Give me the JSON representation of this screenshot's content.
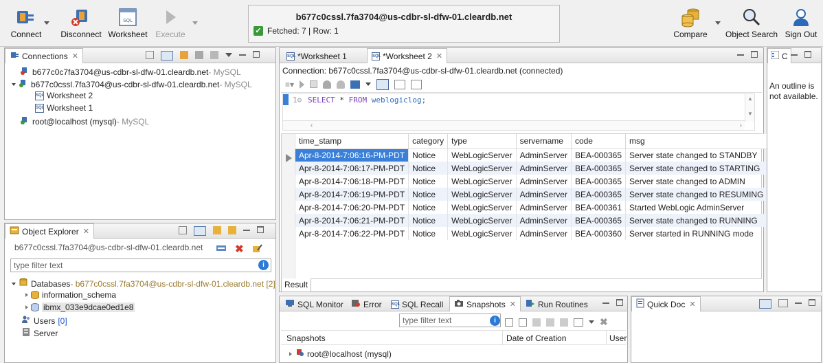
{
  "toolbar": {
    "connect": "Connect",
    "disconnect": "Disconnect",
    "worksheet": "Worksheet",
    "execute": "Execute",
    "compare": "Compare",
    "object_search": "Object Search",
    "sign_out": "Sign Out"
  },
  "status": {
    "title": "b677c0cssl.7fa3704@us-cdbr-sl-dfw-01.cleardb.net",
    "fetched": "Fetched: 7 | Row: 1"
  },
  "connections": {
    "tab": "Connections",
    "items": [
      {
        "name": "b677c0c7fa3704@us-cdbr-sl-dfw-01.cleardb.net",
        "type": " - MySQL"
      },
      {
        "name": "b677c0cssl.7fa3704@us-cdbr-sl-dfw-01.cleardb.net",
        "type": " - MySQL"
      },
      {
        "name": "Worksheet 2"
      },
      {
        "name": "Worksheet 1"
      },
      {
        "name": "root@localhost (mysql)",
        "type": " - MySQL"
      }
    ]
  },
  "object_explorer": {
    "tab": "Object Explorer",
    "connection": "b677c0cssl.7fa3704@us-cdbr-sl-dfw-01.cleardb.net",
    "filter_placeholder": "type filter text",
    "databases_label": "Databases",
    "databases_suffix": " - b677c0cssl.7fa3704@us-cdbr-sl-dfw-01.cleardb.net [2]",
    "schemas": [
      "information_schema",
      "ibmx_033e9dcae0ed1e8"
    ],
    "users_label": "Users",
    "users_count": "[0]",
    "server_label": "Server"
  },
  "editor": {
    "tabs": [
      "*Worksheet 1",
      "*Worksheet 2"
    ],
    "connection": "Connection: b677c0cssl.7fa3704@us-cdbr-sl-dfw-01.cleardb.net (connected)",
    "line_no": "1",
    "sql_kw1": "SELECT",
    "sql_star": " * ",
    "sql_kw2": "FROM",
    "sql_table": " weblogiclog;"
  },
  "result": {
    "columns": [
      "time_stamp",
      "category",
      "type",
      "servername",
      "code",
      "msg"
    ],
    "rows": [
      [
        "Apr-8-2014-7:06:16-PM-PDT",
        "Notice",
        "WebLogicServer",
        "AdminServer",
        "BEA-000365",
        "Server state changed to STANDBY"
      ],
      [
        "Apr-8-2014-7:06:17-PM-PDT",
        "Notice",
        "WebLogicServer",
        "AdminServer",
        "BEA-000365",
        "Server state changed to STARTING"
      ],
      [
        "Apr-8-2014-7:06:18-PM-PDT",
        "Notice",
        "WebLogicServer",
        "AdminServer",
        "BEA-000365",
        "Server state changed to ADMIN"
      ],
      [
        "Apr-8-2014-7:06:19-PM-PDT",
        "Notice",
        "WebLogicServer",
        "AdminServer",
        "BEA-000365",
        "Server state changed to RESUMING"
      ],
      [
        "Apr-8-2014-7:06:20-PM-PDT",
        "Notice",
        "WebLogicServer",
        "AdminServer",
        "BEA-000361",
        "Started WebLogic AdminServer"
      ],
      [
        "Apr-8-2014-7:06:21-PM-PDT",
        "Notice",
        "WebLogicServer",
        "AdminServer",
        "BEA-000365",
        "Server state changed to RUNNING"
      ],
      [
        "Apr-8-2014-7:06:22-PM-PDT",
        "Notice",
        "WebLogicServer",
        "AdminServer",
        "BEA-000360",
        "Server started in RUNNING mode"
      ]
    ],
    "tab": "Result"
  },
  "outline": {
    "tab": "C",
    "message": "An outline is not available."
  },
  "bottom": {
    "tabs": [
      "SQL Monitor",
      "Error",
      "SQL Recall",
      "Snapshots",
      "Run Routines"
    ],
    "filter_placeholder": "type filter text",
    "columns": [
      "Snapshots",
      "Date of Creation",
      "User"
    ],
    "rows": [
      "root@localhost (mysql)"
    ]
  },
  "quickdoc": {
    "tab": "Quick Doc"
  }
}
